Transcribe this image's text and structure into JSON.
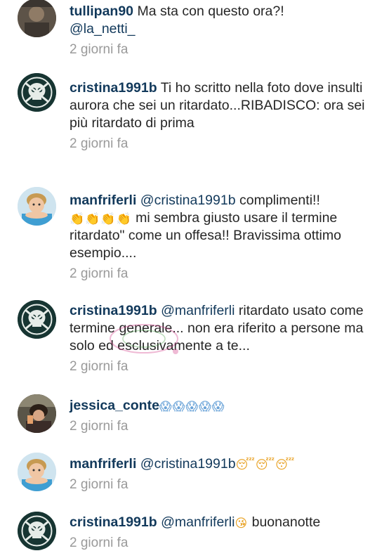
{
  "comments": [
    {
      "username": "tullipan90",
      "text": " Ma sta con questo ora?!",
      "mention": "@la_netti_",
      "time": "2 giorni fa"
    },
    {
      "username": "cristina1991b",
      "text": " Ti ho scritto nella foto dove insulti aurora che sei un ritardato...RIBADISCO: ora sei più ritardato di prima",
      "time": "2 giorni fa"
    },
    {
      "username": "manfriferli",
      "mention": " @cristina1991b",
      "text_a": " complimenti!!",
      "emojis": "👏👏👏👏",
      "text_b": " mi sembra giusto usare il termine ritardato\" come un offesa!! Bravissima ottimo esempio....",
      "time": "2 giorni fa"
    },
    {
      "username": "cristina1991b",
      "mention": " @manfriferli",
      "text": " ritardato usato come termine generale... non era riferito a persone ma solo ed esclusivamente a te...",
      "time": "2 giorni fa"
    },
    {
      "username": "jessica_conte",
      "emojis": " 😱😱😱😱😱",
      "time": "2 giorni fa"
    },
    {
      "username": "manfriferli",
      "mention": " @cristina1991b",
      "emojis": " 😴😴😴",
      "time": "2 giorni fa"
    },
    {
      "username": "cristina1991b",
      "mention": " @manfriferli",
      "emojis": " 😘",
      "text": " buonanotte",
      "time": "2 giorni fa"
    }
  ],
  "icons": {
    "avatar_skull": "skull-avatar-icon",
    "avatar_person": "person-avatar-icon",
    "avatar_photo": "photo-avatar-icon"
  }
}
